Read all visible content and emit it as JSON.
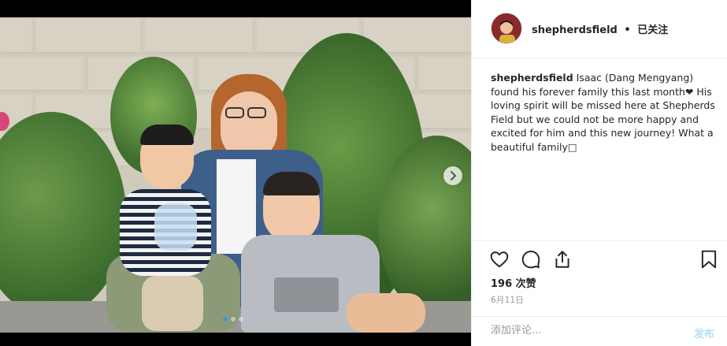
{
  "post": {
    "username": "shepherdsfield",
    "separator": "•",
    "follow_status": "已关注",
    "caption_user": "shepherdsfield",
    "caption_text": "Isaac (Dang Mengyang) found his forever family this last month❤ His loving spirit will be missed here at Shepherds Field but we could not be more happy and excited for him and this new journey! What a beautiful family□",
    "likes": "196 次赞",
    "date": "6月11日",
    "comment_placeholder": "添加评论...",
    "post_button": "发布"
  },
  "carousel": {
    "slide_count": 3,
    "active_slide": 1
  },
  "icons": {
    "like": "heart-icon",
    "comment": "comment-icon",
    "share": "share-icon",
    "save": "bookmark-icon",
    "next": "chevron-right-icon"
  },
  "colors": {
    "text": "#262626",
    "muted": "#999999",
    "border": "#efefef",
    "active_dot": "#3897f0",
    "post_button_disabled": "#b2dffc"
  }
}
